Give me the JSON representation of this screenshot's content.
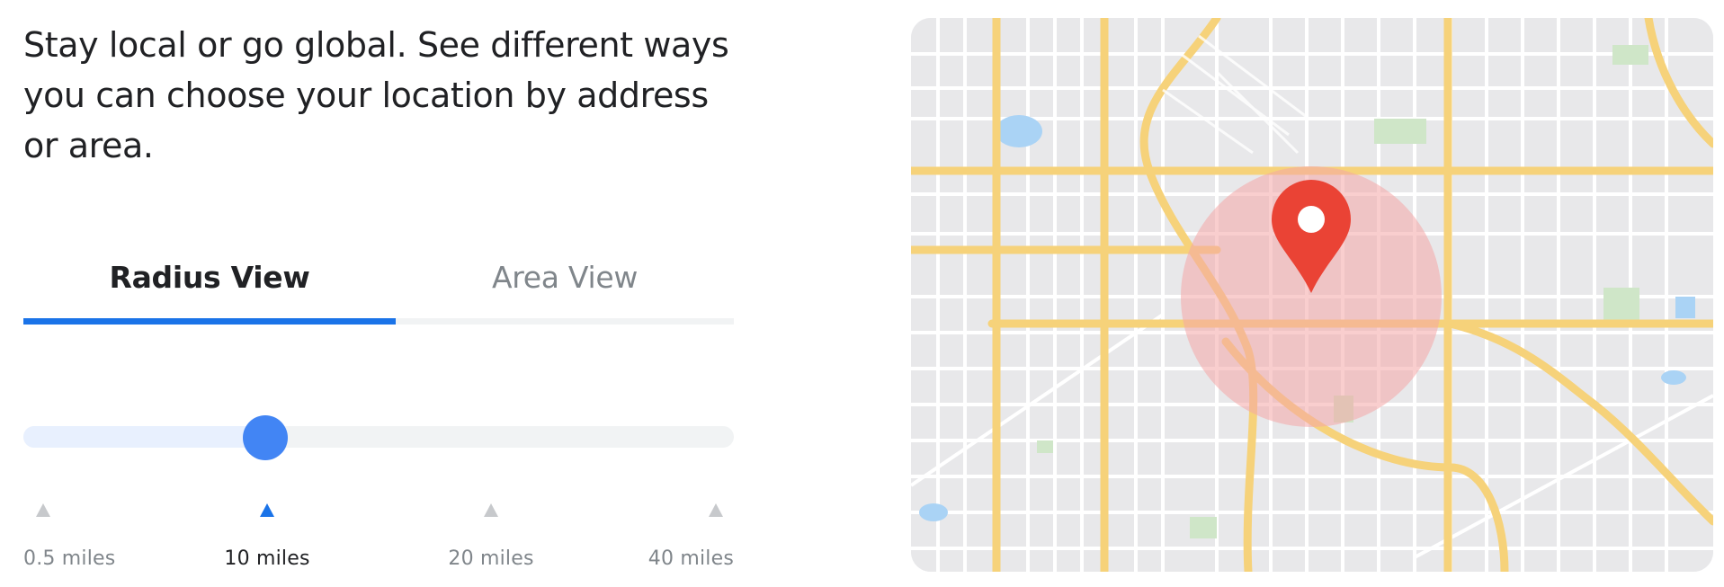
{
  "intro": {
    "text": "Stay local or go global. See different ways you can choose your location by address or area."
  },
  "tabs": [
    {
      "label": "Radius View",
      "active": true
    },
    {
      "label": "Area View",
      "active": false
    }
  ],
  "radius_slider": {
    "selected_label": "10 miles",
    "selected_index": 1,
    "position_fraction": 0.34,
    "stops": [
      "0.5 miles",
      "10 miles",
      "20 miles",
      "40 miles"
    ]
  },
  "map": {
    "pin_icon": "map-pin-icon",
    "radius_circle": "radius-circle",
    "colors": {
      "road_major": "#f6d27a",
      "road_minor": "#ffffff",
      "land": "#e8e8ea",
      "park": "#cfe6c8",
      "water": "#aad3f5",
      "circle_fill": "#f4a6a6",
      "pin": "#ea4335"
    }
  },
  "colors": {
    "accent": "#1a73e8",
    "slider_thumb": "#4285f4",
    "text_primary": "#202124",
    "text_secondary": "#80868b"
  }
}
